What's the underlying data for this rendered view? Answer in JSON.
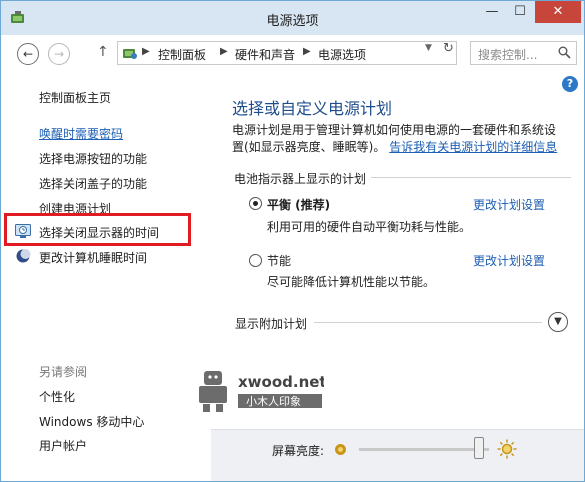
{
  "window": {
    "title": "电源选项",
    "controls": {
      "minimize": "—",
      "maximize": "☐",
      "close": "✕"
    }
  },
  "address": {
    "crumbs": [
      "控制面板",
      "硬件和声音",
      "电源选项"
    ],
    "search_placeholder": "搜索控制..."
  },
  "sidebar": {
    "home": "控制面板主页",
    "links": [
      {
        "label": "唤醒时需要密码",
        "style": "blue-underline"
      },
      {
        "label": "选择电源按钮的功能"
      },
      {
        "label": "选择关闭盖子的功能"
      },
      {
        "label": "创建电源计划"
      },
      {
        "label": "选择关闭显示器的时间",
        "icon": "clock-monitor-icon",
        "highlighted": true
      },
      {
        "label": "更改计算机睡眠时间",
        "icon": "moon-icon"
      }
    ],
    "see_also_heading": "另请参阅",
    "see_also": [
      "个性化",
      "Windows 移动中心",
      "用户帐户"
    ]
  },
  "main": {
    "title": "选择或自定义电源计划",
    "description_text": "电源计划是用于管理计算机如何使用电源的一套硬件和系统设置(如显示器亮度、睡眠等)。",
    "description_link": "告诉我有关电源计划的详细信息",
    "section_label": "电池指示器上显示的计划",
    "plans": [
      {
        "name": "平衡 (推荐)",
        "desc": "利用可用的硬件自动平衡功耗与性能。",
        "selected": true,
        "link": "更改计划设置"
      },
      {
        "name": "节能",
        "desc": "尽可能降低计算机性能以节能。",
        "selected": false,
        "link": "更改计划设置"
      }
    ],
    "more_plans_label": "显示附加计划"
  },
  "watermark": {
    "brand": "xwood.net",
    "subtitle": "小木人印象"
  },
  "brightness": {
    "label": "屏幕亮度:",
    "level_fraction": 0.92
  },
  "colors": {
    "link": "#1c5fb3",
    "title_blue": "#1e4d8c",
    "highlight_red": "#e01b22",
    "close_red": "#c7453b"
  }
}
